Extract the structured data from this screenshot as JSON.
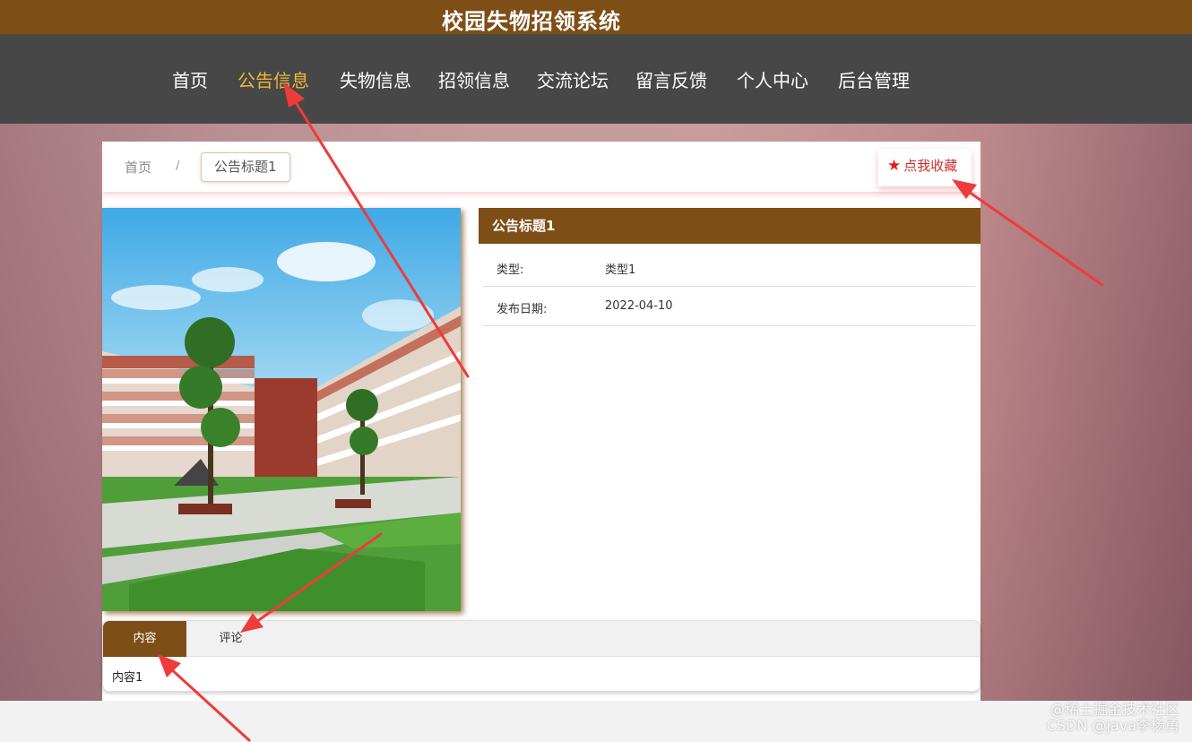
{
  "site_title": "校园失物招领系统",
  "nav": {
    "items": [
      "首页",
      "公告信息",
      "失物信息",
      "招领信息",
      "交流论坛",
      "留言反馈",
      "个人中心",
      "后台管理"
    ],
    "active_index": 1
  },
  "breadcrumb": {
    "home": "首页",
    "separator": "/",
    "current": "公告标题1"
  },
  "favorite": {
    "label": "点我收藏",
    "icon": "star-icon"
  },
  "detail": {
    "title": "公告标题1",
    "type_label": "类型:",
    "type_value": "类型1",
    "date_label": "发布日期:",
    "date_value": "2022-04-10"
  },
  "tabs": {
    "items": [
      "内容",
      "评论"
    ],
    "active_index": 0,
    "content": "内容1"
  },
  "watermark": {
    "line1": "@稀土掘金技术社区",
    "line2": "CSDN @java李杨勇"
  },
  "colors": {
    "brand": "#7d4e16",
    "nav_bg": "#474747",
    "nav_active": "#f0b637",
    "favorite": "#c8302d",
    "annotation_arrow": "#ee3b3b"
  }
}
